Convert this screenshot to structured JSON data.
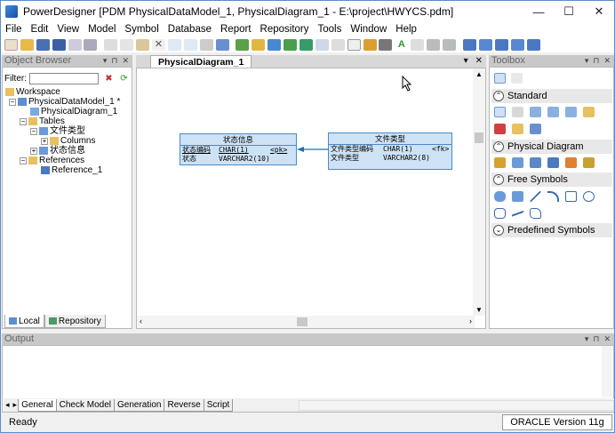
{
  "window": {
    "title": "PowerDesigner [PDM PhysicalDataModel_1, PhysicalDiagram_1 - E:\\project\\HWYCS.pdm]",
    "minimize": "—",
    "maximize": "☐",
    "close": "✕"
  },
  "menu": [
    "File",
    "Edit",
    "View",
    "Model",
    "Symbol",
    "Database",
    "Report",
    "Repository",
    "Tools",
    "Window",
    "Help"
  ],
  "object_browser": {
    "title": "Object Browser",
    "filter_label": "Filter:",
    "tree": {
      "workspace": "Workspace",
      "model": "PhysicalDataModel_1 *",
      "diagram": "PhysicalDiagram_1",
      "tables": "Tables",
      "table1": "文件类型",
      "columns": "Columns",
      "table2": "状态信息",
      "references": "References",
      "ref1": "Reference_1"
    },
    "tabs": {
      "local": "Local",
      "repository": "Repository"
    }
  },
  "diagram": {
    "tab_label": "PhysicalDiagram_1",
    "tables": [
      {
        "name": "状态信息",
        "rows": [
          {
            "col": "状态编码",
            "type": "CHAR(1)",
            "key": "<pk>"
          },
          {
            "col": "状态",
            "type": "VARCHAR2(10)",
            "key": ""
          }
        ]
      },
      {
        "name": "文件类型",
        "rows": [
          {
            "col": "文件类型编码",
            "type": "CHAR(1)",
            "key": "<fk>"
          },
          {
            "col": "文件类型",
            "type": "VARCHAR2(8)",
            "key": ""
          }
        ]
      }
    ]
  },
  "toolbox": {
    "title": "Toolbox",
    "sections": {
      "standard": "Standard",
      "physical": "Physical Diagram",
      "free": "Free Symbols",
      "predefined": "Predefined Symbols"
    }
  },
  "output": {
    "title": "Output",
    "tabs": [
      "General",
      "Check Model",
      "Generation",
      "Reverse",
      "Script"
    ]
  },
  "status": {
    "text": "Ready",
    "dbms": "ORACLE Version 11g"
  },
  "colors": {
    "table_fill": "#cde2f5",
    "table_border": "#4a8ac6",
    "link": "#1f6fb0"
  }
}
